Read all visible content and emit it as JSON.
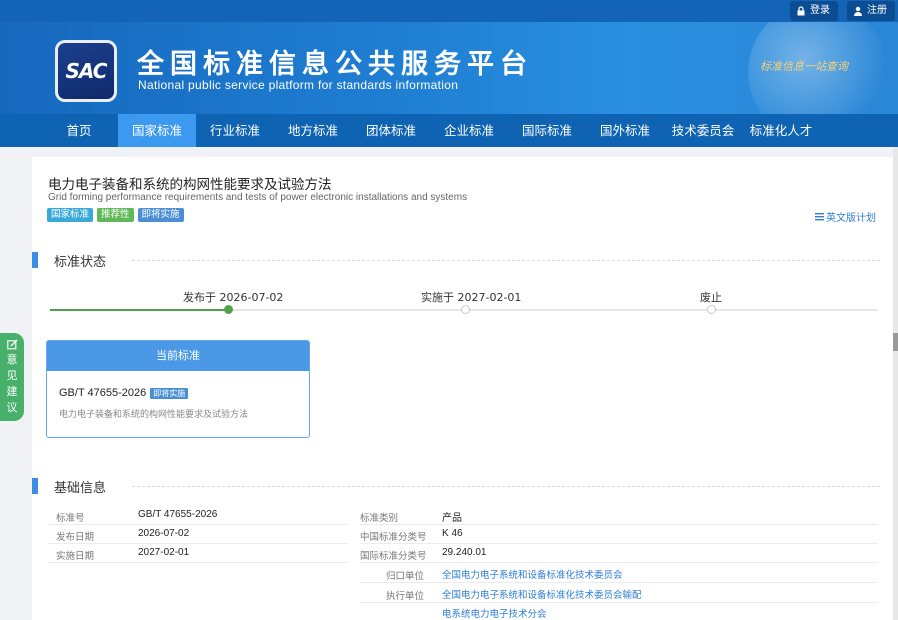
{
  "topbar": {
    "login": "登录",
    "register": "注册"
  },
  "header": {
    "logo_text": "SAC",
    "title": "全国标准信息公共服务平台",
    "subtitle": "National public service platform  for standards information",
    "slogan": "标准信息一站查询"
  },
  "nav": [
    "首页",
    "国家标准",
    "行业标准",
    "地方标准",
    "团体标准",
    "企业标准",
    "国际标准",
    "国外标准",
    "技术委员会",
    "标准化人才"
  ],
  "nav_active": "国家标准",
  "doc": {
    "title_cn": "电力电子装备和系统的构网性能要求及试验方法",
    "title_en": "Grid forming performance requirements and tests of power electronic installations and systems",
    "tags": [
      "国家标准",
      "推荐性",
      "即将实施"
    ],
    "en_plan": "英文版计划"
  },
  "status_section": {
    "heading": "标准状态",
    "timeline": [
      {
        "label": "发布于 2026-07-02",
        "done": true
      },
      {
        "label": "实施于 2027-02-01",
        "done": false
      },
      {
        "label": "废止",
        "done": false
      }
    ]
  },
  "current_standard": {
    "heading": "当前标准",
    "code": "GB/T 47655-2026",
    "badge": "即将实施",
    "name": "电力电子装备和系统的构网性能要求及试验方法"
  },
  "feedback": {
    "chars": [
      "意",
      "见",
      "建",
      "议"
    ]
  },
  "basic_section": {
    "heading": "基础信息",
    "left": [
      {
        "label": "标准号",
        "value": "GB/T 47655-2026"
      },
      {
        "label": "发布日期",
        "value": "2026-07-02"
      },
      {
        "label": "实施日期",
        "value": "2027-02-01"
      }
    ],
    "right": [
      {
        "label": "标准类别",
        "value": "产品",
        "link": false
      },
      {
        "label": "中国标准分类号",
        "value": "K 46",
        "link": false
      },
      {
        "label": "国际标准分类号",
        "value": "29.240.01",
        "link": false
      },
      {
        "label": "归口单位",
        "value": "全国电力电子系统和设备标准化技术委员会",
        "link": true
      },
      {
        "label": "执行单位",
        "value": "全国电力电子系统和设备标准化技术委员会输配",
        "link": true
      },
      {
        "label": "",
        "value": "电系统电力电子技术分会",
        "link": true
      }
    ]
  },
  "colors": {
    "brand": "#1364b6",
    "nav_active": "#3b9af0",
    "accent_green": "#52a24d",
    "link": "#2f7ed3"
  }
}
